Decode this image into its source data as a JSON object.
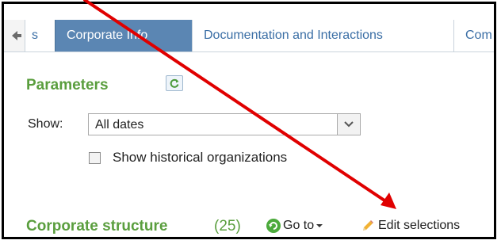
{
  "tabs": {
    "partial_left_label": "s",
    "active_label": "Corporate Info",
    "docs_label": "Documentation and Interactions",
    "partial_right_label": "Com"
  },
  "parameters": {
    "title": "Parameters",
    "show_label": "Show:",
    "show_value": "All dates",
    "checkbox_label": "Show historical organizations",
    "checkbox_checked": false
  },
  "corporate_structure": {
    "title": "Corporate structure",
    "count": "(25)",
    "goto_label": "Go to",
    "edit_label": "Edit selections"
  },
  "colors": {
    "accent_green": "#5a9e3e",
    "tab_active": "#5b86b3",
    "tab_text": "#3a6ea5",
    "annotation_red": "#e00000"
  },
  "icons": {
    "tab_scroll": "arrow-left-icon",
    "refresh": "refresh-icon",
    "dropdown": "chevron-down-icon",
    "goto": "goto-circle-arrow-icon",
    "goto_caret": "caret-down-icon",
    "edit": "pencil-icon"
  }
}
